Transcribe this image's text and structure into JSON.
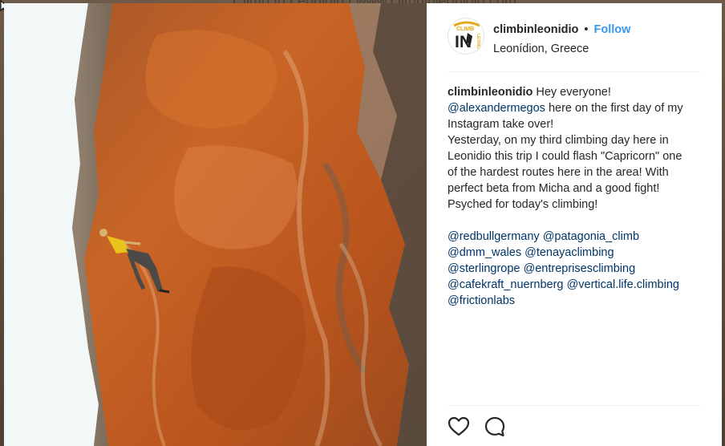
{
  "browser": {
    "title": "Climb In Leonidio | www.climbinleonidio.com"
  },
  "post": {
    "username": "climbinleonidio",
    "separator": "•",
    "follow_label": "Follow",
    "location": "Leonídion, Greece",
    "avatar_text": {
      "top": "CLIMB",
      "big": "IN",
      "side": "LEONIDIO"
    },
    "caption": {
      "owner": "climbinleonidio",
      "line1": " Hey everyone!",
      "mention1": "@alexandermegos",
      "line2": " here on the first day of my",
      "line3": "Instagram take over!",
      "line4": "Yesterday, on my third climbing day here in",
      "line5": "Leonidio this trip I could flash \"Capricorn\" one",
      "line6": "of the hardest routes here in the area! With",
      "line7": "perfect beta from Micha and a good fight!",
      "line8": "Psyched for today's climbing!",
      "tags": [
        [
          "@redbullgermany",
          "@patagonia_climb"
        ],
        [
          "@dmm_wales",
          "@tenayaclimbing"
        ],
        [
          "@sterlingrope",
          "@entreprisesclimbing"
        ],
        [
          "@cafekraft_nuernberg",
          "@vertical.life.climbing"
        ],
        [
          "@frictionlabs"
        ]
      ]
    },
    "actions": {
      "like_icon": "heart-icon",
      "comment_icon": "speech-bubble-icon"
    }
  },
  "colors": {
    "link": "#003569",
    "follow": "#3897f0",
    "rock": "#c0581f",
    "sky": "#f2f7f8"
  }
}
